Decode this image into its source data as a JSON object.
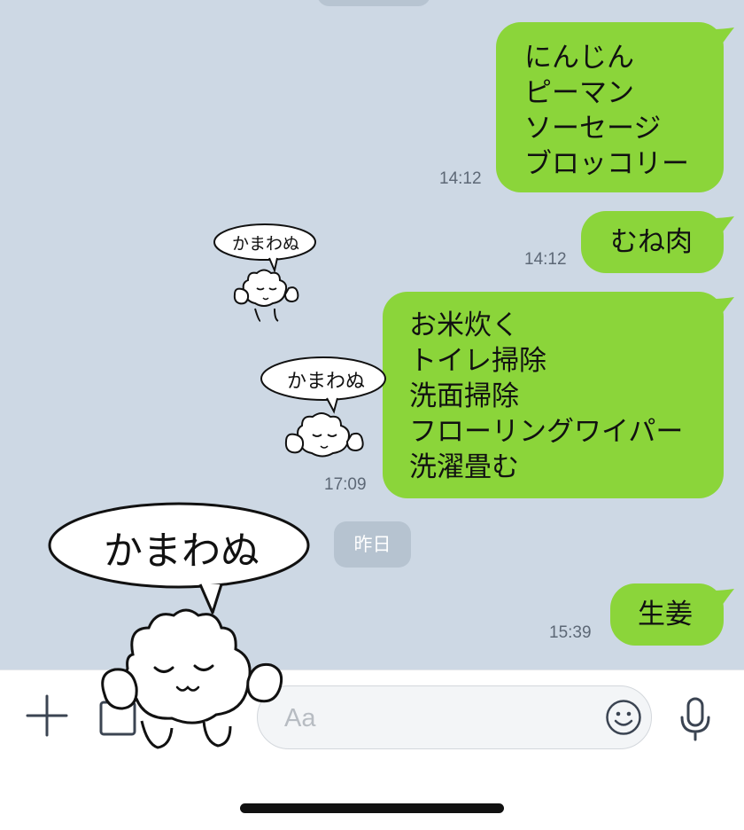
{
  "messages": [
    {
      "text": "にんじん\nピーマン\nソーセージ\nブロッコリー",
      "time": "14:12"
    },
    {
      "text": "むね肉",
      "time": "14:12"
    },
    {
      "text": "お米炊く\nトイレ掃除\n洗面掃除\nフローリングワイパー\n洗濯畳む",
      "time": "17:09"
    },
    {
      "text": "生姜",
      "time": "15:39"
    }
  ],
  "stickers": [
    {
      "word": "かまわぬ"
    },
    {
      "word": "かまわぬ"
    },
    {
      "word": "かまわぬ"
    }
  ],
  "date_separator": "昨日",
  "input": {
    "placeholder": "Aa"
  },
  "icons": {
    "add": "plus-icon",
    "image": "image-icon",
    "emoji": "smiley-icon",
    "mic": "microphone-icon"
  },
  "colors": {
    "chat_background": "#cdd8e4",
    "sent_bubble": "#8bd53a",
    "date_pill": "#b6c3d0"
  }
}
